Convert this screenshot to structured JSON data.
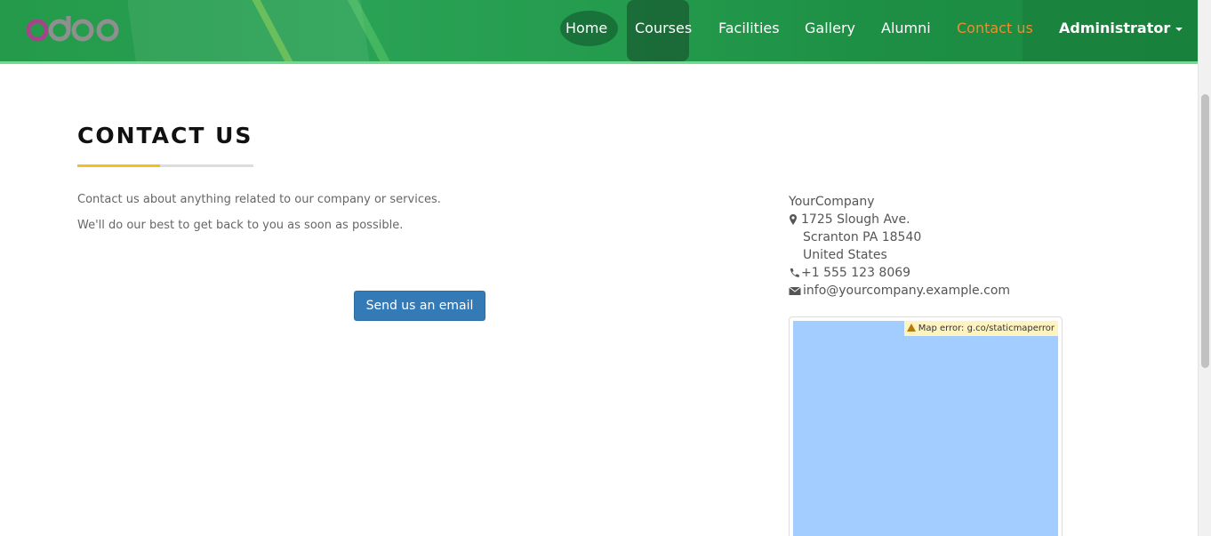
{
  "header": {
    "logo_text": "odoo",
    "nav": [
      {
        "label": "Home",
        "active": false
      },
      {
        "label": "Courses",
        "active": false
      },
      {
        "label": "Facilities",
        "active": false
      },
      {
        "label": "Gallery",
        "active": false
      },
      {
        "label": "Alumni",
        "active": false
      },
      {
        "label": "Contact us",
        "active": true
      },
      {
        "label": "Administrator",
        "active": false
      }
    ],
    "colors": {
      "bar": "#249a4a",
      "active_link": "#f28b2b",
      "underline": "#6fdc8d"
    }
  },
  "main": {
    "title": "CONTACT US",
    "intro_line1": "Contact us about anything related to our company or services.",
    "intro_line2": "We'll do our best to get back to you as soon as possible.",
    "email_button": "Send us an email"
  },
  "company": {
    "name": "YourCompany",
    "street": "1725 Slough Ave.",
    "city_line": "Scranton PA 18540",
    "country": "United States",
    "phone": "+1 555 123 8069",
    "email": "info@yourcompany.example.com"
  },
  "map": {
    "error_text": "Map error: g.co/staticmaperror",
    "color": "#a3ccff"
  },
  "icons": [
    "map-marker-icon",
    "phone-icon",
    "envelope-icon",
    "warning-icon",
    "caret-down-icon"
  ]
}
